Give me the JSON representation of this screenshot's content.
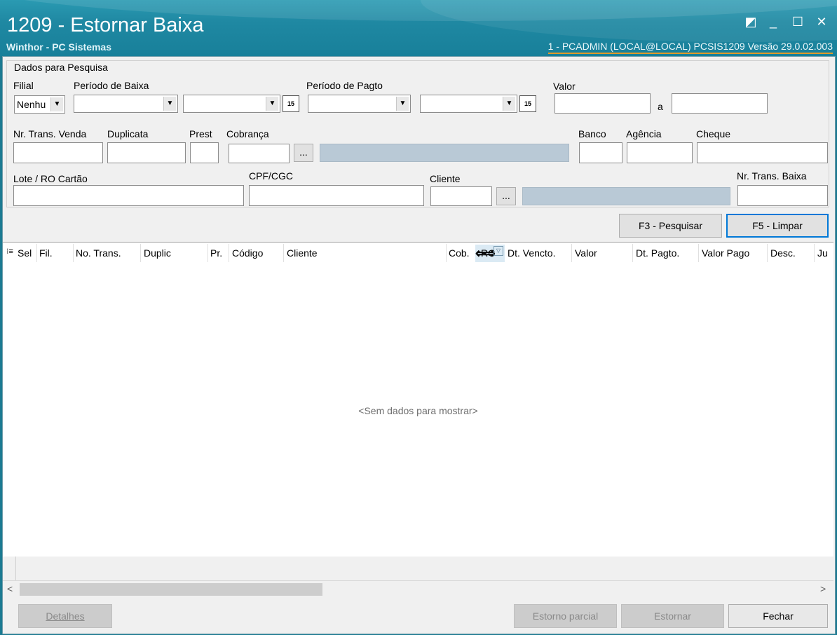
{
  "window": {
    "title": "1209 - Estornar Baixa",
    "subtitle": "Winthor - PC Sistemas",
    "session_info": "1 - PCADMIN (LOCAL@LOCAL)   PCSIS1209  Versão  29.0.02.003",
    "controls": {
      "restore": "◩",
      "minimize": "_",
      "maximize": "☐",
      "close": "✕"
    }
  },
  "search": {
    "legend": "Dados para Pesquisa",
    "filial": {
      "label": "Filial",
      "value": "Nenhu"
    },
    "periodo_baixa": {
      "label": "Período de Baixa",
      "from": "",
      "to": ""
    },
    "periodo_pagto": {
      "label": "Período de Pagto",
      "from": "",
      "to": ""
    },
    "valor": {
      "label": "Valor",
      "from": "",
      "separator": "a",
      "to": ""
    },
    "nr_trans_venda": {
      "label": "Nr. Trans. Venda",
      "value": ""
    },
    "duplicata": {
      "label": "Duplicata",
      "value": ""
    },
    "prest": {
      "label": "Prest",
      "value": ""
    },
    "cobranca": {
      "label": "Cobrança",
      "value": "",
      "description": ""
    },
    "banco": {
      "label": "Banco",
      "value": ""
    },
    "agencia": {
      "label": "Agência",
      "value": ""
    },
    "cheque": {
      "label": "Cheque",
      "value": ""
    },
    "lote_ro_cartao": {
      "label": "Lote / RO Cartão",
      "value": ""
    },
    "cpf_cgc": {
      "label": "CPF/CGC",
      "value": ""
    },
    "cliente": {
      "label": "Cliente",
      "value": "",
      "description": ""
    },
    "nr_trans_baixa": {
      "label": "Nr. Trans. Baixa",
      "value": ""
    },
    "ellipsis": "...",
    "calendar_icon_text": "15"
  },
  "actions": {
    "pesquisar": "F3 - Pesquisar",
    "limpar": "F5 - Limpar"
  },
  "grid": {
    "columns": [
      "Sel",
      "Fil.",
      "No. Trans.",
      "Duplic",
      "Pr.",
      "Código",
      "Cliente",
      "Cob.",
      "RC",
      "Dt. Vencto.",
      "Valor",
      "Dt. Pagto.",
      "Valor Pago",
      "Desc.",
      "Ju"
    ],
    "empty_message": "<Sem dados para mostrar>"
  },
  "footer": {
    "detalhes": "Detalhes",
    "estorno_parcial": "Estorno parcial",
    "estornar": "Estornar",
    "fechar": "Fechar"
  }
}
